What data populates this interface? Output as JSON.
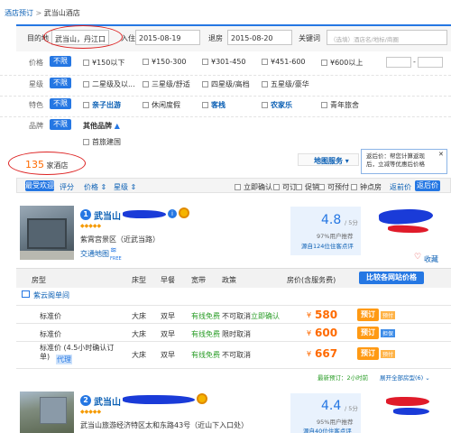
{
  "breadcrumb": {
    "part1": "酒店预订",
    "sep": ">",
    "part2": "武当山酒店"
  },
  "search": {
    "dest_label": "目的地",
    "dest_value": "武当山，丹江口（",
    "checkin_label": "入住",
    "checkin_value": "2015-08-19",
    "checkout_label": "退房",
    "checkout_value": "2015-08-20",
    "keyword_label": "关键词",
    "keyword_placeholder": "（选填）酒店名/地标/商圈"
  },
  "filters": {
    "price": {
      "label": "价格",
      "unlimited": "不限",
      "options": [
        "¥150以下",
        "¥150-300",
        "¥301-450",
        "¥451-600",
        "¥600以上"
      ],
      "range_sep": "-"
    },
    "star": {
      "label": "星级",
      "unlimited": "不限",
      "options": [
        "二星级及以...",
        "三星级/舒适",
        "四星级/高档",
        "五星级/豪华"
      ]
    },
    "feature": {
      "label": "特色",
      "unlimited": "不限",
      "options": [
        "亲子出游",
        "休闲度假",
        "客栈",
        "农家乐",
        "青年旅舍"
      ]
    },
    "brand": {
      "label": "品牌",
      "unlimited": "不限",
      "other": "其他品牌",
      "options": [
        "首旅建国"
      ]
    }
  },
  "result_count": {
    "number": "135",
    "unit": "家酒店"
  },
  "map_service": "地图服务",
  "tooltip": {
    "text": "返后价：帮您计算返现后，立减等优惠后价格",
    "close": "✕"
  },
  "sort_bar": {
    "items": [
      "最受欢迎",
      "评分",
      "价格 ⇕",
      "星级 ⇕"
    ],
    "checks": [
      "立即确认",
      "可订",
      "促销",
      "可预付",
      "钟点房"
    ],
    "prices": [
      "返前价",
      "返后价"
    ]
  },
  "hotel1": {
    "index": "1",
    "name": "武当山",
    "location": "紫霄宫景区（近武当路）",
    "traffic": "交通地图",
    "wifi": "FREE",
    "score": "4.8",
    "score_max": "/ 5分",
    "recommend": "97%用户推荐",
    "reviews": "源自124位住客点评",
    "fav": "收藏",
    "table_headers": [
      "房型",
      "床型",
      "早餐",
      "宽带",
      "政策",
      "房价(含服务费)"
    ],
    "compare_btn": "比较各网站价格",
    "room_type": "紫云阁单间",
    "rows": [
      {
        "name": "标准价",
        "bed": "大床",
        "breakfast": "双早",
        "net": "有线免费",
        "policy": "不可取消",
        "confirm": "立即确认",
        "price": "580",
        "tag": "预付"
      },
      {
        "name": "标准价",
        "bed": "大床",
        "breakfast": "双早",
        "net": "有线免费",
        "policy": "限时取消",
        "confirm": "",
        "price": "600",
        "tag": "担保"
      },
      {
        "name": "标准价  (4.5小时确认订单)",
        "extra": "代理",
        "bed": "大床",
        "breakfast": "双早",
        "net": "有线免费",
        "policy": "不可取消",
        "confirm": "",
        "price": "667",
        "tag": "预付"
      }
    ],
    "book": "预订",
    "currency": "¥",
    "latest": "最新预订：2小时前",
    "expand": "展开全部房型(6)"
  },
  "hotel2": {
    "index": "2",
    "name": "武当山",
    "address": "武当山旅游经济特区太和东路43号（近山下入口处）",
    "score": "4.4",
    "score_max": "/ 5分",
    "recommend": "95%用户推荐",
    "reviews": "源自40位住客点评"
  },
  "colors": {
    "accent": "#2577e3",
    "orange": "#ff9a14",
    "red_marker": "#d22222"
  }
}
